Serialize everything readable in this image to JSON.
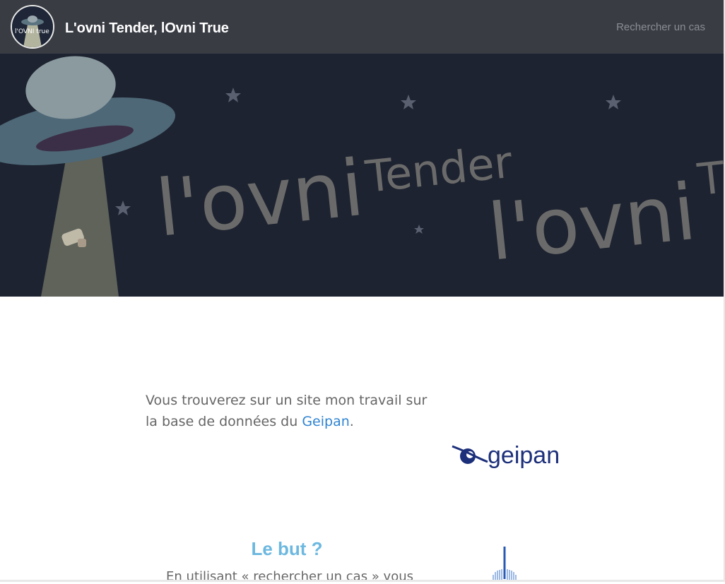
{
  "header": {
    "site_title": "L'ovni Tender, lOvni True",
    "search_link": "Rechercher un cas",
    "logo_text": "l'OVNI true",
    "bg_color": "#393c43"
  },
  "hero": {
    "banner_text_1": "l'ovni",
    "banner_text_2": "Tender",
    "banner_text_3": "l'ovni",
    "banner_text_4": "T"
  },
  "intro": {
    "text_before": "Vous trouverez sur un site mon travail sur la base de données du ",
    "link_text": "Geipan",
    "text_after": ".",
    "link_color": "#2f84d2"
  },
  "geipan_logo": {
    "wordmark": "geipan",
    "color": "#1c2f7a"
  },
  "section": {
    "title": "Le but ?",
    "title_color": "#6cb8e0",
    "text": "En utilisant « rechercher un cas » vous"
  }
}
